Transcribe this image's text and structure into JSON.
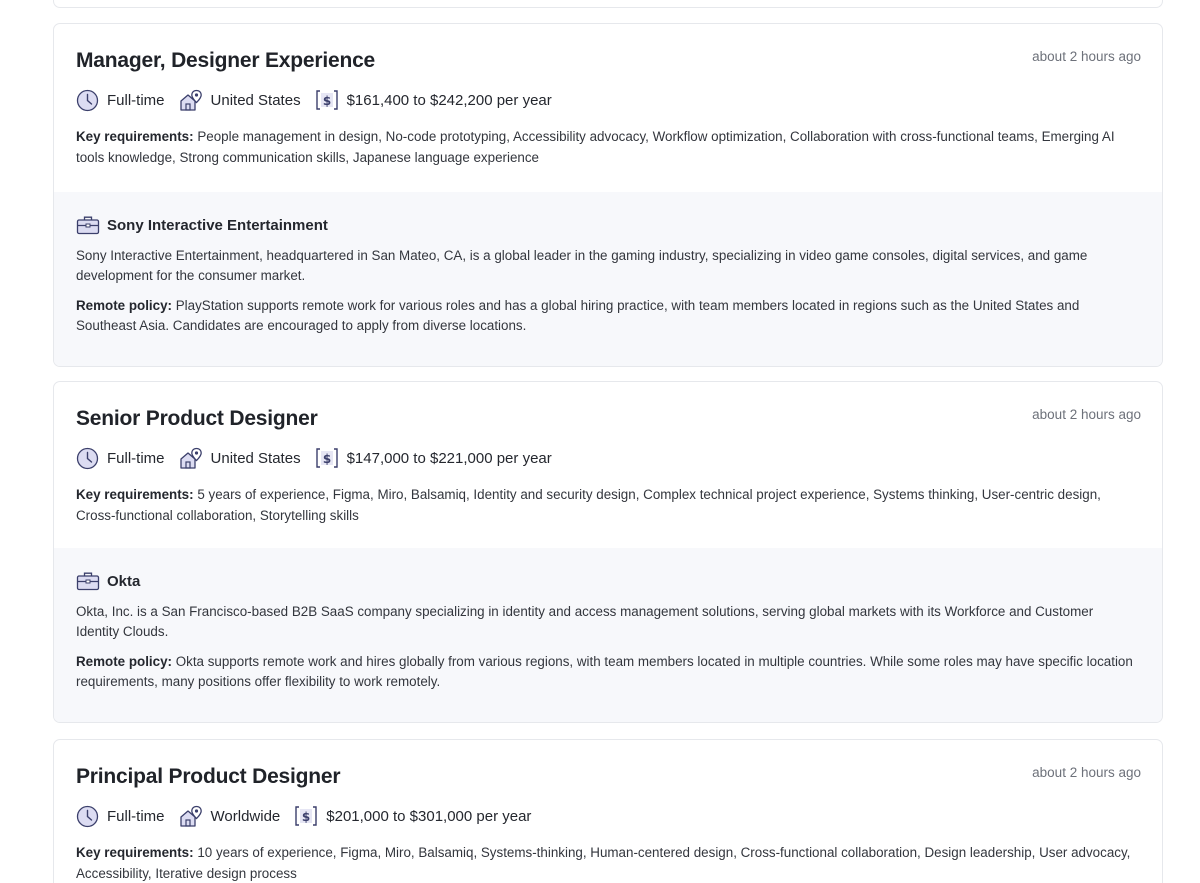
{
  "jobs": [
    {
      "title": "Manager, Designer Experience",
      "posted": "about 2 hours ago",
      "employment_type": "Full-time",
      "location": "United States",
      "salary": "$161,400 to $242,200 per year",
      "requirements_label": "Key requirements:",
      "requirements": "People management in design, No-code prototyping, Accessibility advocacy, Workflow optimization, Collaboration with cross-functional teams, Emerging AI tools knowledge, Strong communication skills, Japanese language experience",
      "company": {
        "name": "Sony Interactive Entertainment",
        "description": "Sony Interactive Entertainment, headquartered in San Mateo, CA, is a global leader in the gaming industry, specializing in video game consoles, digital services, and game development for the consumer market.",
        "remote_label": "Remote policy:",
        "remote_policy": "PlayStation supports remote work for various roles and has a global hiring practice, with team members located in regions such as the United States and Southeast Asia. Candidates are encouraged to apply from diverse locations."
      }
    },
    {
      "title": "Senior Product Designer",
      "posted": "about 2 hours ago",
      "employment_type": "Full-time",
      "location": "United States",
      "salary": "$147,000 to $221,000 per year",
      "requirements_label": "Key requirements:",
      "requirements": "5 years of experience, Figma, Miro, Balsamiq, Identity and security design, Complex technical project experience, Systems thinking, User-centric design, Cross-functional collaboration, Storytelling skills",
      "company": {
        "name": "Okta",
        "description": "Okta, Inc. is a San Francisco-based B2B SaaS company specializing in identity and access management solutions, serving global markets with its Workforce and Customer Identity Clouds.",
        "remote_label": "Remote policy:",
        "remote_policy": "Okta supports remote work and hires globally from various regions, with team members located in multiple countries. While some roles may have specific location requirements, many positions offer flexibility to work remotely."
      }
    },
    {
      "title": "Principal Product Designer",
      "posted": "about 2 hours ago",
      "employment_type": "Full-time",
      "location": "Worldwide",
      "salary": "$201,000 to $301,000 per year",
      "requirements_label": "Key requirements:",
      "requirements": "10 years of experience, Figma, Miro, Balsamiq, Systems-thinking, Human-centered design, Cross-functional collaboration, Design leadership, User advocacy, Accessibility, Iterative design process"
    }
  ],
  "icons": {
    "employment_type": "clock-icon",
    "location": "house-location-icon",
    "salary": "dollar-icon",
    "company": "briefcase-icon"
  },
  "colors": {
    "icon_stroke": "#3b3f6b",
    "icon_fill": "#dcdcf2",
    "company_panel_bg": "#f7f8fb",
    "card_border": "#e6e8ec"
  }
}
